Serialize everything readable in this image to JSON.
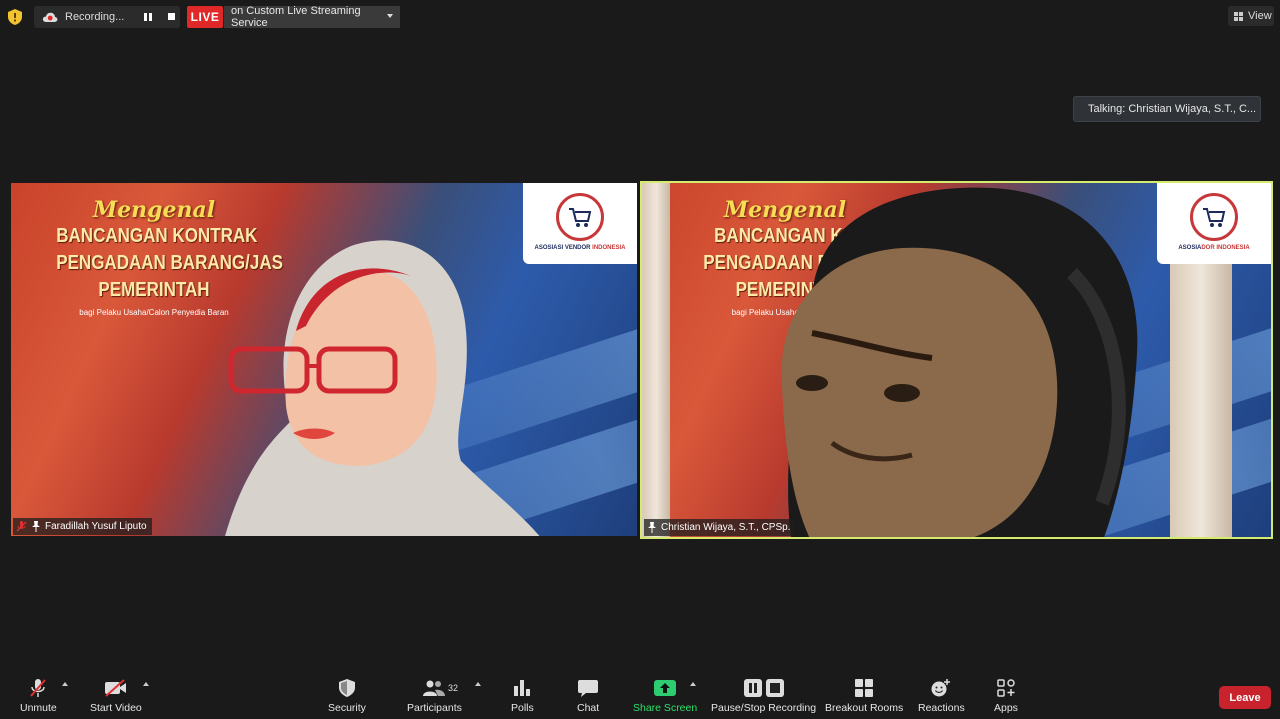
{
  "top": {
    "recording_label": "Recording...",
    "live_label": "LIVE",
    "stream_service": "on Custom Live Streaming Service",
    "view_label": "View"
  },
  "talking_indicator": "Talking: Christian Wijaya, S.T., C...",
  "tiles": [
    {
      "participant": "Faradillah Yusuf Liputo",
      "muted": true,
      "slide": {
        "line1": "Mengenal",
        "line2": "BANCANGAN KONTRAK",
        "line3": "PENGADAAN BARANG/JAS",
        "line4": "PEMERINTAH",
        "subtitle": "bagi Pelaku Usaha/Calon Penyedia Baran",
        "logo_text_a": "ASOSIASI VENDOR ",
        "logo_text_b": "INDONESIA"
      }
    },
    {
      "participant": "Christian Wijaya, S.T., CPSp.",
      "muted": false,
      "active_speaker": true,
      "slide": {
        "line1": "Mengenal",
        "line2": "BANCANGAN KO",
        "line3": "PENGADAAN BARA",
        "line4": "PEMERINTA",
        "subtitle": "bagi Pelaku Usaha/Calon Pen",
        "logo_text_a": "ASOSIA",
        "logo_text_b": "DOR INDONESIA"
      }
    }
  ],
  "toolbar": {
    "unmute": "Unmute",
    "start_video": "Start Video",
    "security": "Security",
    "participants": "Participants",
    "participants_count": "32",
    "polls": "Polls",
    "chat": "Chat",
    "share_screen": "Share Screen",
    "pause_stop_recording": "Pause/Stop Recording",
    "breakout_rooms": "Breakout Rooms",
    "reactions": "Reactions",
    "apps": "Apps",
    "leave": "Leave"
  },
  "colors": {
    "live_red": "#e02828",
    "active_speaker_border": "#d5eb6d",
    "share_green": "#2ee06a",
    "leave_red": "#c8232c"
  }
}
